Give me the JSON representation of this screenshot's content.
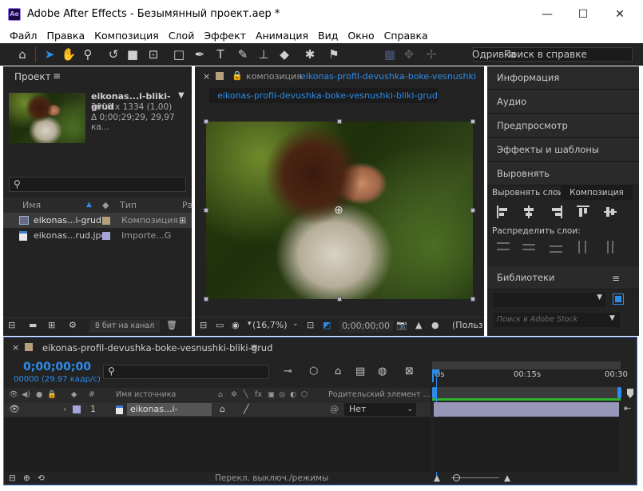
{
  "window": {
    "app_icon": "Ae",
    "title": "Adobe After Effects - Безымянный проект.aep *",
    "minimize": "—",
    "maximize": "☐",
    "close": "✕"
  },
  "menu": [
    "Файл",
    "Правка",
    "Композиция",
    "Слой",
    "Эффект",
    "Анимация",
    "Вид",
    "Окно",
    "Справка"
  ],
  "toolbar": {
    "workspace_label": "Одривка",
    "search_placeholder": "Поиск в справке"
  },
  "project": {
    "title": "Проект",
    "item_name": "eikonas...i-bliki-grud",
    "item_dims": "2000 x 1334 (1,00)",
    "item_duration": "Δ 0;00;29;29, 29,97 ка...",
    "search_placeholder": "",
    "columns": {
      "name": "Имя",
      "type": "Тип",
      "extra": "Ра"
    },
    "items": [
      {
        "name": "eikonas...i-grud",
        "type": "Композиция",
        "label_color": "#b5a07a",
        "icon": "composition-icon"
      },
      {
        "name": "eikonas...rud.jpg",
        "type": "Importe...G",
        "label_color": "#a5a5d8",
        "icon": "image-file-icon"
      }
    ],
    "footer_bit_depth": "8 бит на канал"
  },
  "composition": {
    "title_prefix": "композиция",
    "comp_name": "eikonas-profil-devushka-boke-vesnushki-bliki-b",
    "tab": "eikonas-profil-devushka-boke-vesnushki-bliki-grud",
    "zoom": "(16,7%)",
    "timecode": "0;00;00;00",
    "view_mode": "(Польз"
  },
  "right_panel": {
    "items": [
      "Информация",
      "Аудио",
      "Предпросмотр",
      "Эффекты и шаблоны",
      "Выровнять"
    ],
    "align_to_label": "Выровнять слои",
    "align_to_value": "Композиция",
    "distribute_label": "Распределить слои:",
    "libraries": "Библиотеки",
    "adobe_stock_placeholder": "Поиск в Adobe Stock"
  },
  "timeline": {
    "comp_name": "eikonas-profil-devushka-boke-vesnushki-bliki-grud",
    "timecode": "0;00;00;00",
    "frames": "00000 (29.97 кадр/с)",
    "columns": {
      "num": "#",
      "source": "Имя источника",
      "parent": "Родительский элемент ..."
    },
    "ruler": [
      "0s",
      "00:15s",
      "00:30"
    ],
    "layer": {
      "index": "1",
      "name": "eikonas...i-grud.jpg",
      "parent": "Нет",
      "label_color": "#a5a5d8"
    },
    "footer_toggle": "Перекл. выключ./режимы"
  },
  "colors": {
    "accent": "#2d8ceb",
    "panel_bg": "#232323",
    "work_area": "#2db52d"
  }
}
